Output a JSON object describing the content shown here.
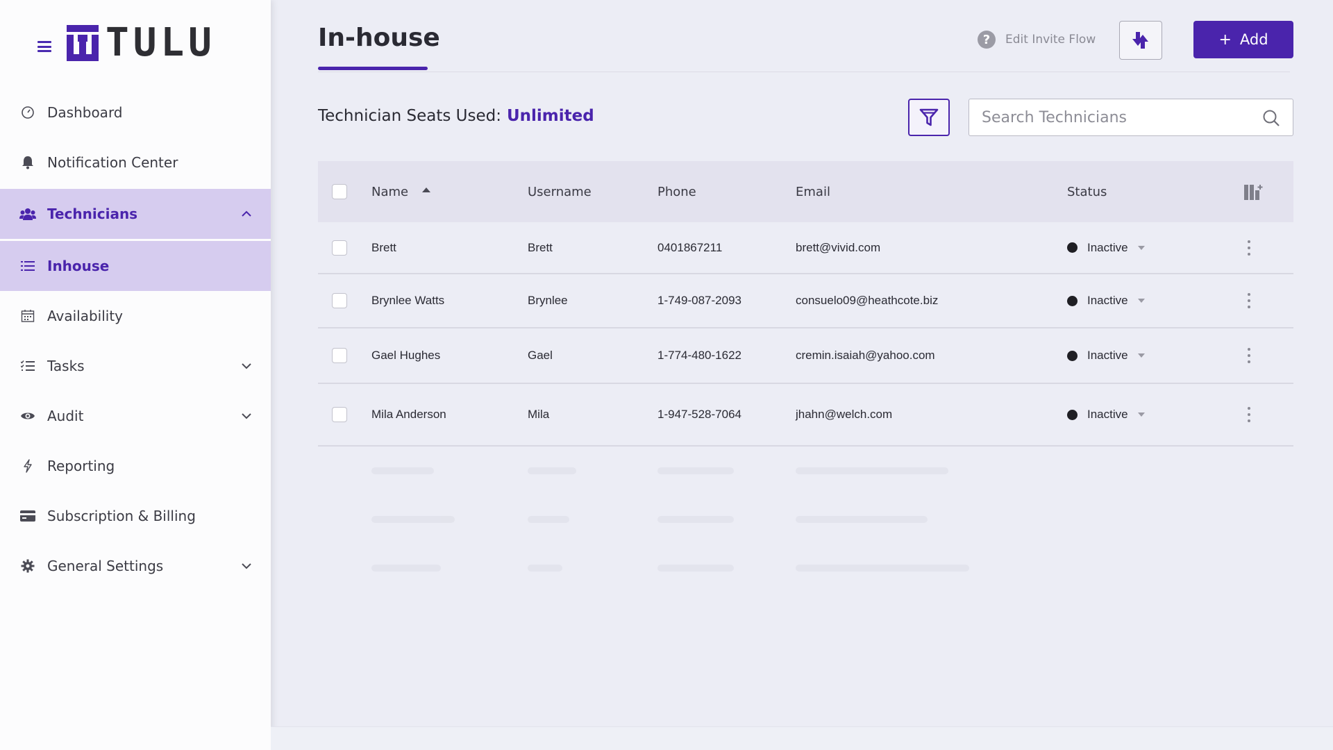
{
  "app": {
    "logo_text": "TULU"
  },
  "sidebar": {
    "items": [
      {
        "label": "Dashboard",
        "icon": "gauge-icon"
      },
      {
        "label": "Notification Center",
        "icon": "bell-icon"
      },
      {
        "label": "Technicians",
        "icon": "users-icon",
        "expanded": true
      },
      {
        "label": "Inhouse",
        "icon": "list-icon",
        "active": true
      },
      {
        "label": "Availability",
        "icon": "calendar-icon"
      },
      {
        "label": "Tasks",
        "icon": "tasks-icon",
        "expandable": true
      },
      {
        "label": "Audit",
        "icon": "eye-icon",
        "expandable": true
      },
      {
        "label": "Reporting",
        "icon": "bolt-icon"
      },
      {
        "label": "Subscription & Billing",
        "icon": "credit-card-icon"
      },
      {
        "label": "General Settings",
        "icon": "gear-icon",
        "expandable": true
      }
    ]
  },
  "header": {
    "title": "In-house",
    "help_label": "Edit Invite Flow",
    "add_label": "Add"
  },
  "seats": {
    "label": "Technician Seats Used:",
    "value": "Unlimited"
  },
  "search": {
    "placeholder": "Search Technicians"
  },
  "table": {
    "columns": [
      "Name",
      "Username",
      "Phone",
      "Email",
      "Status"
    ],
    "sort": {
      "column": "Name",
      "direction": "ascending"
    },
    "rows": [
      {
        "name": "Brett",
        "username": "Brett",
        "phone": "0401867211",
        "email": "brett@vivid.com",
        "status": "Inactive"
      },
      {
        "name": "Brynlee Watts",
        "username": "Brynlee",
        "phone": "1-749-087-2093",
        "email": "consuelo09@heathcote.biz",
        "status": "Inactive"
      },
      {
        "name": "Gael Hughes",
        "username": "Gael",
        "phone": "1-774-480-1622",
        "email": "cremin.isaiah@yahoo.com",
        "status": "Inactive"
      },
      {
        "name": "Mila Anderson",
        "username": "Mila",
        "phone": "1-947-528-7064",
        "email": "jhahn@welch.com",
        "status": "Inactive"
      }
    ]
  },
  "colors": {
    "accent": "#4a24ac",
    "active_bg": "#d6ccef",
    "status_dot": "#1f1f24"
  }
}
